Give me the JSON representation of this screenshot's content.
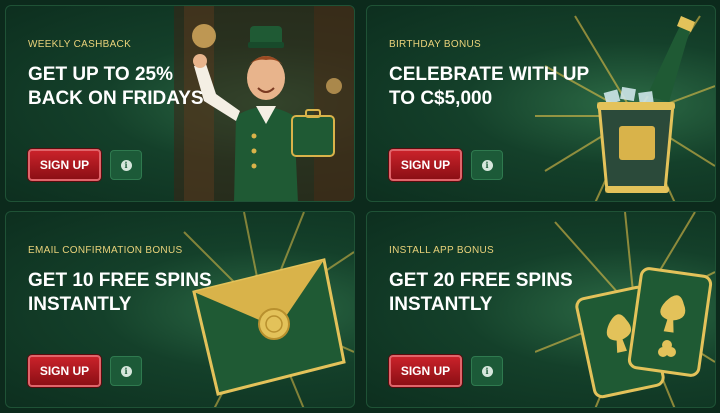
{
  "cards": [
    {
      "eyebrow": "WEEKLY CASHBACK",
      "headline": "GET UP TO 25% BACK ON FRIDAYS",
      "signup_label": "SIGN UP",
      "info_icon": "info-icon",
      "art": "bellhop-illustration"
    },
    {
      "eyebrow": "BIRTHDAY BONUS",
      "headline": "CELEBRATE WITH UP TO C$5,000",
      "signup_label": "SIGN UP",
      "info_icon": "info-icon",
      "art": "champagne-bucket-illustration"
    },
    {
      "eyebrow": "EMAIL CONFIRMATION BONUS",
      "headline": "GET 10 FREE SPINS INSTANTLY",
      "signup_label": "SIGN UP",
      "info_icon": "info-icon",
      "art": "envelope-illustration"
    },
    {
      "eyebrow": "INSTALL APP BONUS",
      "headline": "GET 20 FREE SPINS INSTANTLY",
      "signup_label": "SIGN UP",
      "info_icon": "info-icon",
      "art": "playing-cards-illustration"
    }
  ],
  "info_glyph": "i",
  "colors": {
    "background": "#0c2a1c",
    "card": "#14402a",
    "eyebrow": "#e9d27a",
    "signup": "#c9222a",
    "info_button": "#1c5a38",
    "gold": "#d9b34a"
  }
}
